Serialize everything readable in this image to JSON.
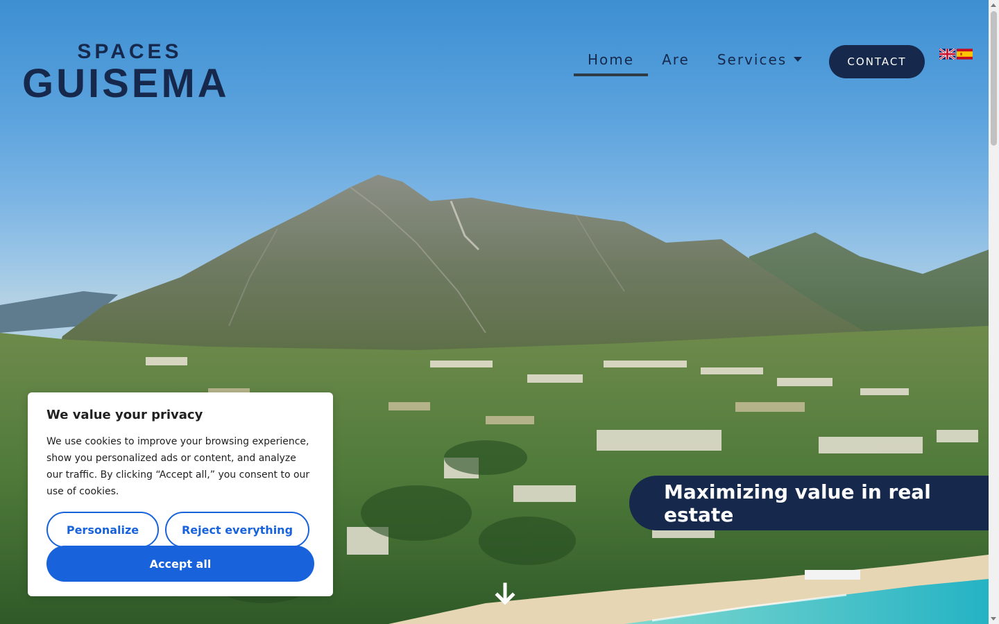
{
  "brand": {
    "line1": "SPACES",
    "line2": "GUISEMA"
  },
  "nav": {
    "items": [
      {
        "label": "Home",
        "active": true
      },
      {
        "label": "Are",
        "active": false
      },
      {
        "label": "Services",
        "active": false,
        "has_dropdown": true
      }
    ],
    "contact_label": "CONTACT",
    "languages": [
      {
        "code": "en",
        "icon": "uk-flag-icon"
      },
      {
        "code": "es",
        "icon": "spain-flag-icon"
      }
    ]
  },
  "hero": {
    "tagline": "Maximizing value in real estate",
    "scroll_icon": "arrow-down-icon"
  },
  "cookie_banner": {
    "title": "We value your privacy",
    "body": "We use cookies to improve your browsing experience, show you personalized ads or content, and analyze our traffic. By clicking “Accept all,” you consent to our use of cookies.",
    "personalize_label": "Personalize",
    "reject_label": "Reject everything",
    "accept_label": "Accept all"
  },
  "colors": {
    "brand_navy": "#16294d",
    "cookie_blue": "#1863dc",
    "sky": "#5aa2dd",
    "sea": "#3fc7c4"
  }
}
